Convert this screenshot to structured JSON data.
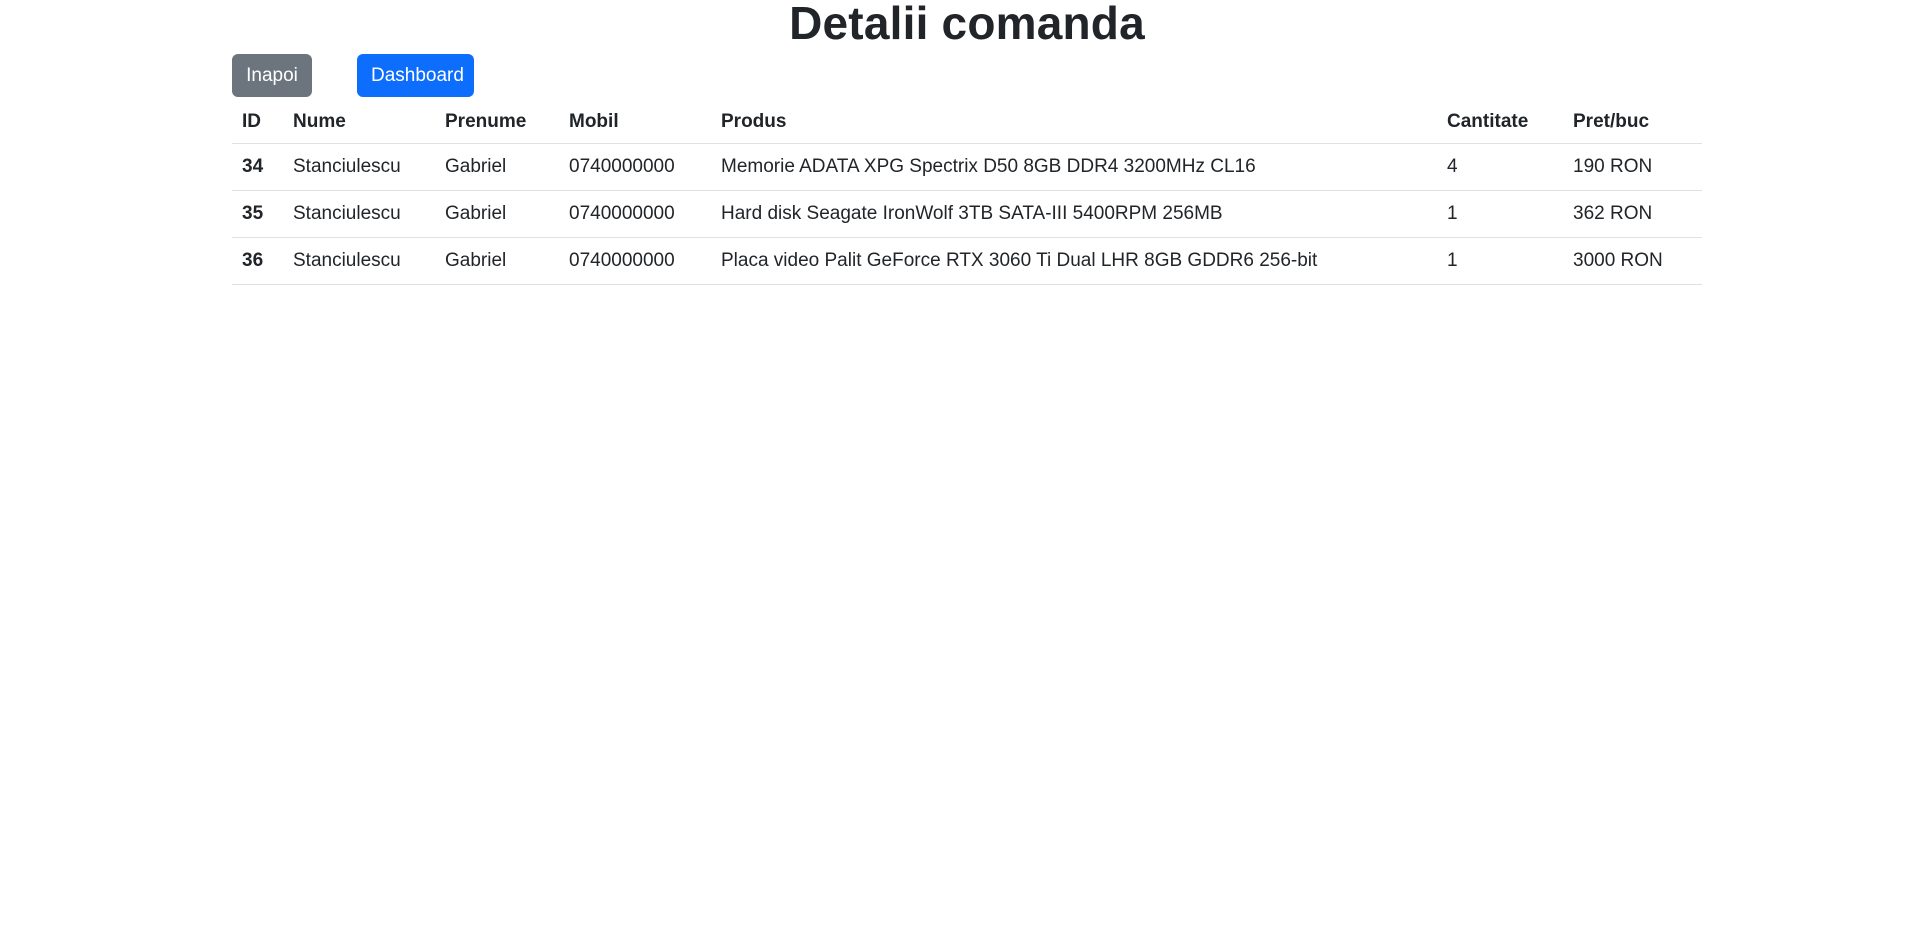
{
  "page": {
    "title": "Detalii comanda"
  },
  "toolbar": {
    "back_label": "Inapoi",
    "dashboard_label": "Dashboard"
  },
  "colors": {
    "secondary_button": "#6c757d",
    "primary_button": "#0d6efd",
    "text": "#212529",
    "row_border": "#dee2e6"
  },
  "table": {
    "headers": [
      "ID",
      "Nume",
      "Prenume",
      "Mobil",
      "Produs",
      "Cantitate",
      "Pret/buc"
    ],
    "rows": [
      {
        "id": "34",
        "nume": "Stanciulescu",
        "prenume": "Gabriel",
        "mobil": "0740000000",
        "produs": "Memorie ADATA XPG Spectrix D50 8GB DDR4 3200MHz CL16",
        "cantitate": "4",
        "pret": "190 RON"
      },
      {
        "id": "35",
        "nume": "Stanciulescu",
        "prenume": "Gabriel",
        "mobil": "0740000000",
        "produs": "Hard disk Seagate IronWolf 3TB SATA-III 5400RPM 256MB",
        "cantitate": "1",
        "pret": "362 RON"
      },
      {
        "id": "36",
        "nume": "Stanciulescu",
        "prenume": "Gabriel",
        "mobil": "0740000000",
        "produs": "Placa video Palit GeForce RTX 3060 Ti Dual LHR 8GB GDDR6 256-bit",
        "cantitate": "1",
        "pret": "3000 RON"
      }
    ]
  }
}
